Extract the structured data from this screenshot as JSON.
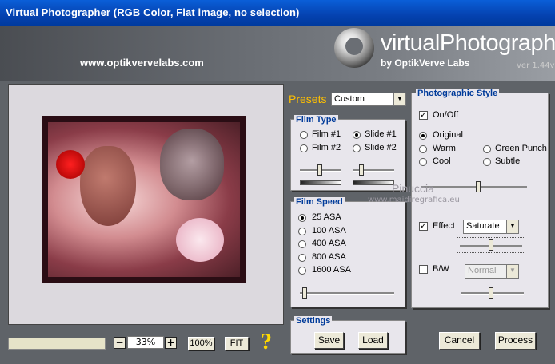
{
  "window": {
    "title": "Virtual Photographer (RGB Color, Flat image, no selection)"
  },
  "header": {
    "url": "www.optikvervelabs.com",
    "logo_text": "virtualPhotographer",
    "logo_sub": "by OptikVerve Labs",
    "version": "ver 1.44v"
  },
  "zoom": {
    "minus": "−",
    "value": "33%",
    "plus": "+",
    "hundred": "100%",
    "fit": "FIT",
    "help": "?"
  },
  "presets": {
    "label": "Presets",
    "value": "Custom"
  },
  "film_type": {
    "title": "Film Type",
    "options": [
      "Film #1",
      "Slide #1",
      "Film #2",
      "Slide #2"
    ],
    "selected": "Slide #1"
  },
  "film_speed": {
    "title": "Film Speed",
    "options": [
      "25 ASA",
      "100 ASA",
      "400 ASA",
      "800 ASA",
      "1600 ASA"
    ],
    "selected": "25 ASA"
  },
  "settings": {
    "title": "Settings",
    "save": "Save",
    "load": "Load"
  },
  "photographic_style": {
    "title": "Photographic Style",
    "onoff": "On/Off",
    "onoff_checked": true,
    "styles": [
      "Original",
      "Warm",
      "Green Punch",
      "Cool",
      "Subtle"
    ],
    "selected": "Original",
    "effect_label": "Effect",
    "effect_checked": true,
    "effect_value": "Saturate",
    "bw_label": "B/W",
    "bw_checked": false,
    "bw_value": "Normal"
  },
  "watermark": {
    "name": "Pinuccia",
    "site": "www.maidiregrafica.eu"
  },
  "actions": {
    "cancel": "Cancel",
    "process": "Process"
  },
  "colors": {
    "titlebar": "#0542b0",
    "presets": "#ffc000",
    "legend": "#003b9a"
  }
}
